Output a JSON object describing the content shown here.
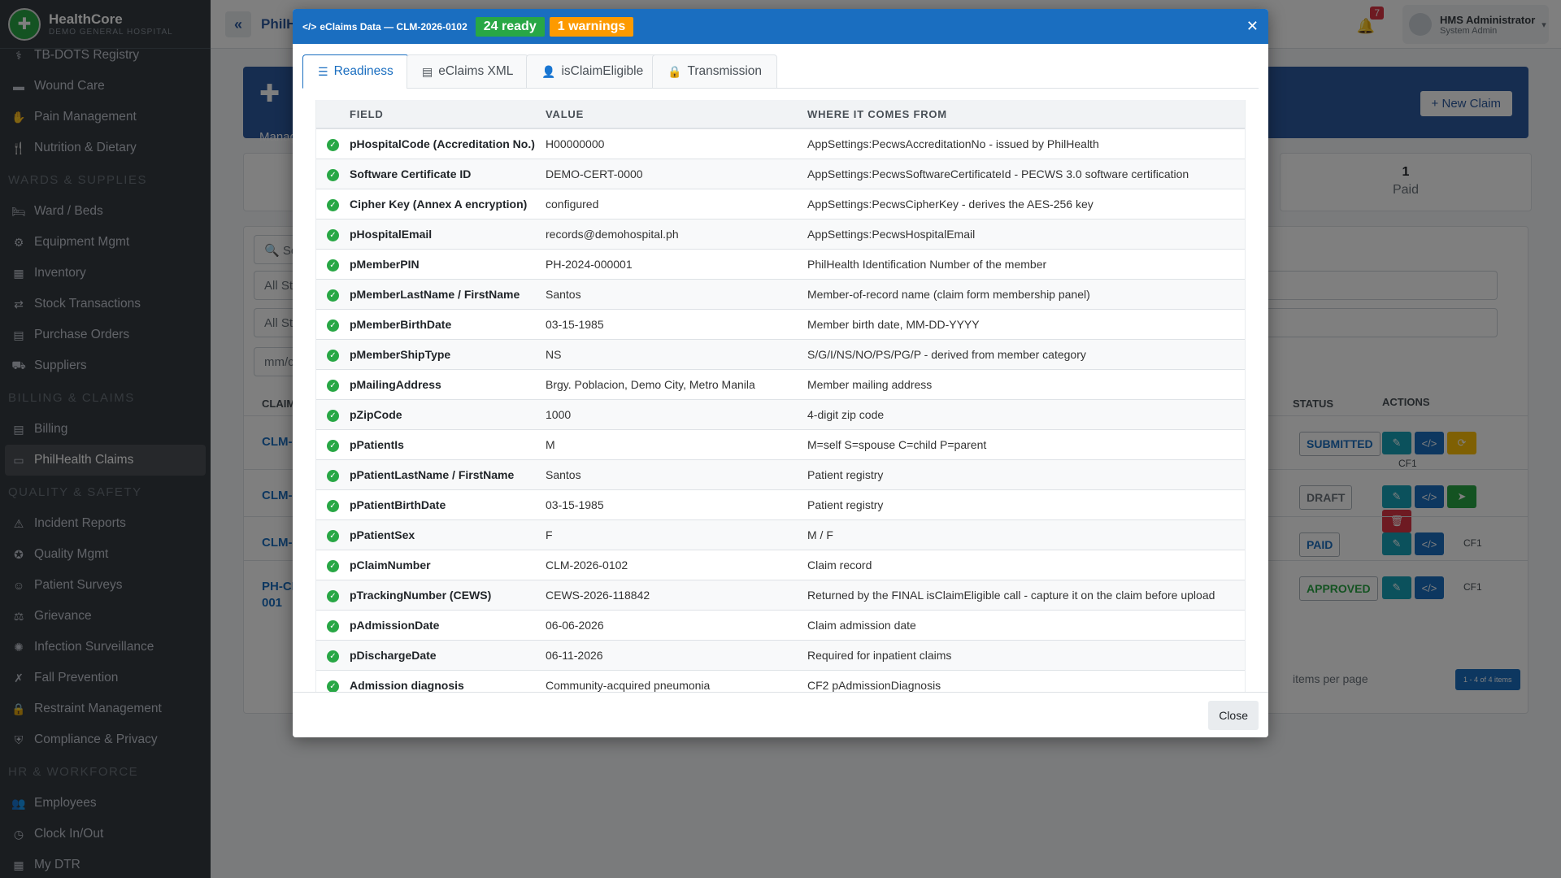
{
  "brand": {
    "name": "HealthCore",
    "subtitle": "DEMO GENERAL HOSPITAL"
  },
  "sidebar": {
    "groups": [
      {
        "items": [
          {
            "label": "TB-DOTS Registry",
            "icon": "lungs-icon",
            "glyph": "⚕"
          },
          {
            "label": "Wound Care",
            "icon": "bandage-icon",
            "glyph": "▬"
          },
          {
            "label": "Pain Management",
            "icon": "hand-icon",
            "glyph": "✋"
          },
          {
            "label": "Nutrition & Dietary",
            "icon": "utensils-icon",
            "glyph": "🍴"
          }
        ]
      },
      {
        "header": "WARDS & SUPPLIES",
        "items": [
          {
            "label": "Ward / Beds",
            "icon": "bed-icon",
            "glyph": "🛏"
          },
          {
            "label": "Equipment Mgmt",
            "icon": "tools-icon",
            "glyph": "⚙"
          },
          {
            "label": "Inventory",
            "icon": "boxes-icon",
            "glyph": "▦"
          },
          {
            "label": "Stock Transactions",
            "icon": "exchange-icon",
            "glyph": "⇄"
          },
          {
            "label": "Purchase Orders",
            "icon": "file-icon",
            "glyph": "▤"
          },
          {
            "label": "Suppliers",
            "icon": "truck-icon",
            "glyph": "⛟"
          }
        ]
      },
      {
        "header": "BILLING & CLAIMS",
        "items": [
          {
            "label": "Billing",
            "icon": "invoice-icon",
            "glyph": "▤"
          },
          {
            "label": "PhilHealth Claims",
            "icon": "id-card-icon",
            "glyph": "▭",
            "active": true
          }
        ]
      },
      {
        "header": "QUALITY & SAFETY",
        "items": [
          {
            "label": "Incident Reports",
            "icon": "warning-icon",
            "glyph": "⚠"
          },
          {
            "label": "Quality Mgmt",
            "icon": "award-icon",
            "glyph": "✪"
          },
          {
            "label": "Patient Surveys",
            "icon": "smile-icon",
            "glyph": "☺"
          },
          {
            "label": "Grievance",
            "icon": "scale-icon",
            "glyph": "⚖"
          },
          {
            "label": "Infection Surveillance",
            "icon": "virus-icon",
            "glyph": "✺"
          },
          {
            "label": "Fall Prevention",
            "icon": "person-falling-icon",
            "glyph": "✗"
          },
          {
            "label": "Restraint Management",
            "icon": "lock-icon",
            "glyph": "🔒"
          },
          {
            "label": "Compliance & Privacy",
            "icon": "shield-icon",
            "glyph": "⛨"
          }
        ]
      },
      {
        "header": "HR & WORKFORCE",
        "items": [
          {
            "label": "Employees",
            "icon": "users-icon",
            "glyph": "👥"
          },
          {
            "label": "Clock In/Out",
            "icon": "clock-icon",
            "glyph": "◷"
          },
          {
            "label": "My DTR",
            "icon": "calendar-icon",
            "glyph": "▦"
          }
        ]
      }
    ]
  },
  "topbar": {
    "title": "PhilHe",
    "notif_count": "7",
    "user_name": "HMS Administrator",
    "user_role": "System Admin"
  },
  "content": {
    "banner_text": "Manag",
    "new_claim": "New Claim",
    "stat_value": "1",
    "stat_label": "Paid",
    "search_placeholder": "Sea",
    "filter1": "All St",
    "filter2": "All St",
    "date_placeholder": "mm/c",
    "col_claim": "CLAIM",
    "col_status": "STATUS",
    "col_actions": "ACTIONS",
    "rows": [
      {
        "claim": "CLM-",
        "status": "SUBMITTED",
        "status_color": "#1a6ec0"
      },
      {
        "claim": "CLM-",
        "status": "DRAFT",
        "status_color": "#6c757d"
      },
      {
        "claim": "CLM-",
        "status": "PAID",
        "status_color": "#1a6ec0"
      },
      {
        "claim": "PH-CI",
        "claim2": "001",
        "status": "APPROVED",
        "status_color": "#28a745"
      }
    ],
    "cf1": "CF1",
    "per_page": "items per page",
    "pager": "1 - 4 of 4 items"
  },
  "modal": {
    "title": "eClaims Data — CLM-2026-0102",
    "badge_ready": "24 ready",
    "badge_warn": "1 warnings",
    "tabs": [
      {
        "label": "Readiness",
        "icon": "list-check-icon",
        "glyph": "☰"
      },
      {
        "label": "eClaims XML",
        "icon": "file-code-icon",
        "glyph": "▤"
      },
      {
        "label": "isClaimEligible",
        "icon": "user-check-icon",
        "glyph": "👤"
      },
      {
        "label": "Transmission",
        "icon": "lock-icon",
        "glyph": "🔒"
      }
    ],
    "columns": [
      "FIELD",
      "VALUE",
      "WHERE IT COMES FROM"
    ],
    "rows": [
      [
        "pHospitalCode (Accreditation No.)",
        "H00000000",
        "AppSettings:PecwsAccreditationNo - issued by PhilHealth"
      ],
      [
        "Software Certificate ID",
        "DEMO-CERT-0000",
        "AppSettings:PecwsSoftwareCertificateId - PECWS 3.0 software certification"
      ],
      [
        "Cipher Key (Annex A encryption)",
        "configured",
        "AppSettings:PecwsCipherKey - derives the AES-256 key"
      ],
      [
        "pHospitalEmail",
        "records@demohospital.ph",
        "AppSettings:PecwsHospitalEmail"
      ],
      [
        "pMemberPIN",
        "PH-2024-000001",
        "PhilHealth Identification Number of the member"
      ],
      [
        "pMemberLastName / FirstName",
        "Santos",
        "Member-of-record name (claim form membership panel)"
      ],
      [
        "pMemberBirthDate",
        "03-15-1985",
        "Member birth date, MM-DD-YYYY"
      ],
      [
        "pMemberShipType",
        "NS",
        "S/G/I/NS/NO/PS/PG/P - derived from member category"
      ],
      [
        "pMailingAddress",
        "Brgy. Poblacion, Demo City, Metro Manila",
        "Member mailing address"
      ],
      [
        "pZipCode",
        "1000",
        "4-digit zip code"
      ],
      [
        "pPatientIs",
        "M",
        "M=self S=spouse C=child P=parent"
      ],
      [
        "pPatientLastName / FirstName",
        "Santos",
        "Patient registry"
      ],
      [
        "pPatientBirthDate",
        "03-15-1985",
        "Patient registry"
      ],
      [
        "pPatientSex",
        "F",
        "M / F"
      ],
      [
        "pClaimNumber",
        "CLM-2026-0102",
        "Claim record"
      ],
      [
        "pTrackingNumber (CEWS)",
        "CEWS-2026-118842",
        "Returned by the FINAL isClaimEligible call - capture it on the claim before upload"
      ],
      [
        "pAdmissionDate",
        "06-06-2026",
        "Claim admission date"
      ],
      [
        "pDischargeDate",
        "06-11-2026",
        "Required for inpatient claims"
      ],
      [
        "Admission diagnosis",
        "Community-acquired pneumonia",
        "CF2 pAdmissionDiagnosis"
      ]
    ],
    "close_label": "Close"
  }
}
